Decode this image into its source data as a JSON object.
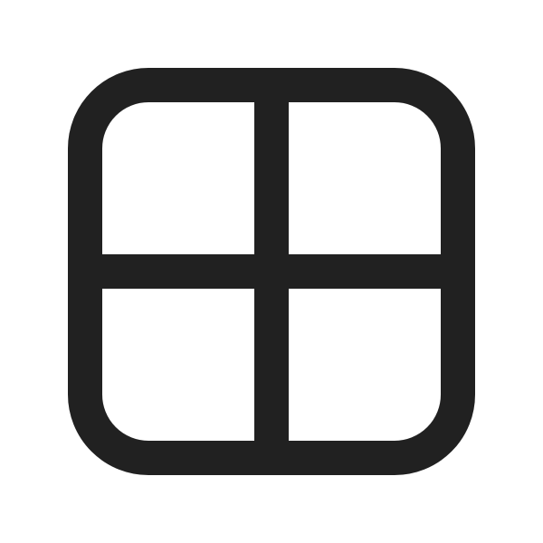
{
  "icon": {
    "name": "grid-four-icon",
    "stroke_color": "#212121",
    "background_color": "#ffffff"
  }
}
